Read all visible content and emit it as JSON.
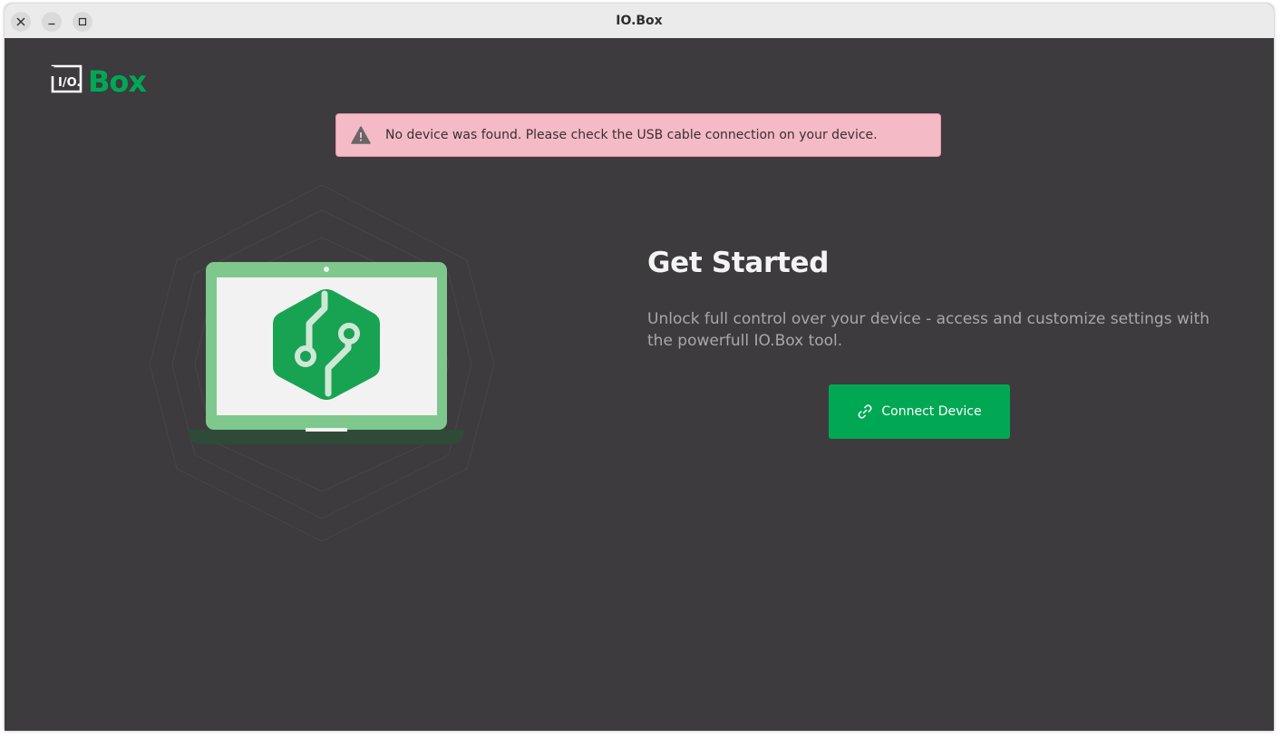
{
  "window": {
    "title": "IO.Box",
    "controls": [
      "close-icon",
      "minimize-icon",
      "maximize-icon"
    ]
  },
  "logo": {
    "badge_text": "I/O.",
    "wordmark": "Box",
    "brand_color": "#00a854"
  },
  "alert": {
    "icon": "warning-icon",
    "message": "No device was found. Please check the USB cable connection on your device.",
    "background": "#f4bac6"
  },
  "hero": {
    "heading": "Get Started",
    "description": "Unlock full control over your device - access and customize settings with the powerfull IO.Box tool."
  },
  "connect_button": {
    "label": "Connect Device",
    "icon": "link-icon",
    "color": "#00a854"
  },
  "colors": {
    "background": "#3d3b3e",
    "accent": "#00a854",
    "laptop_frame": "#7ec88e",
    "laptop_base": "#2f4a38"
  }
}
